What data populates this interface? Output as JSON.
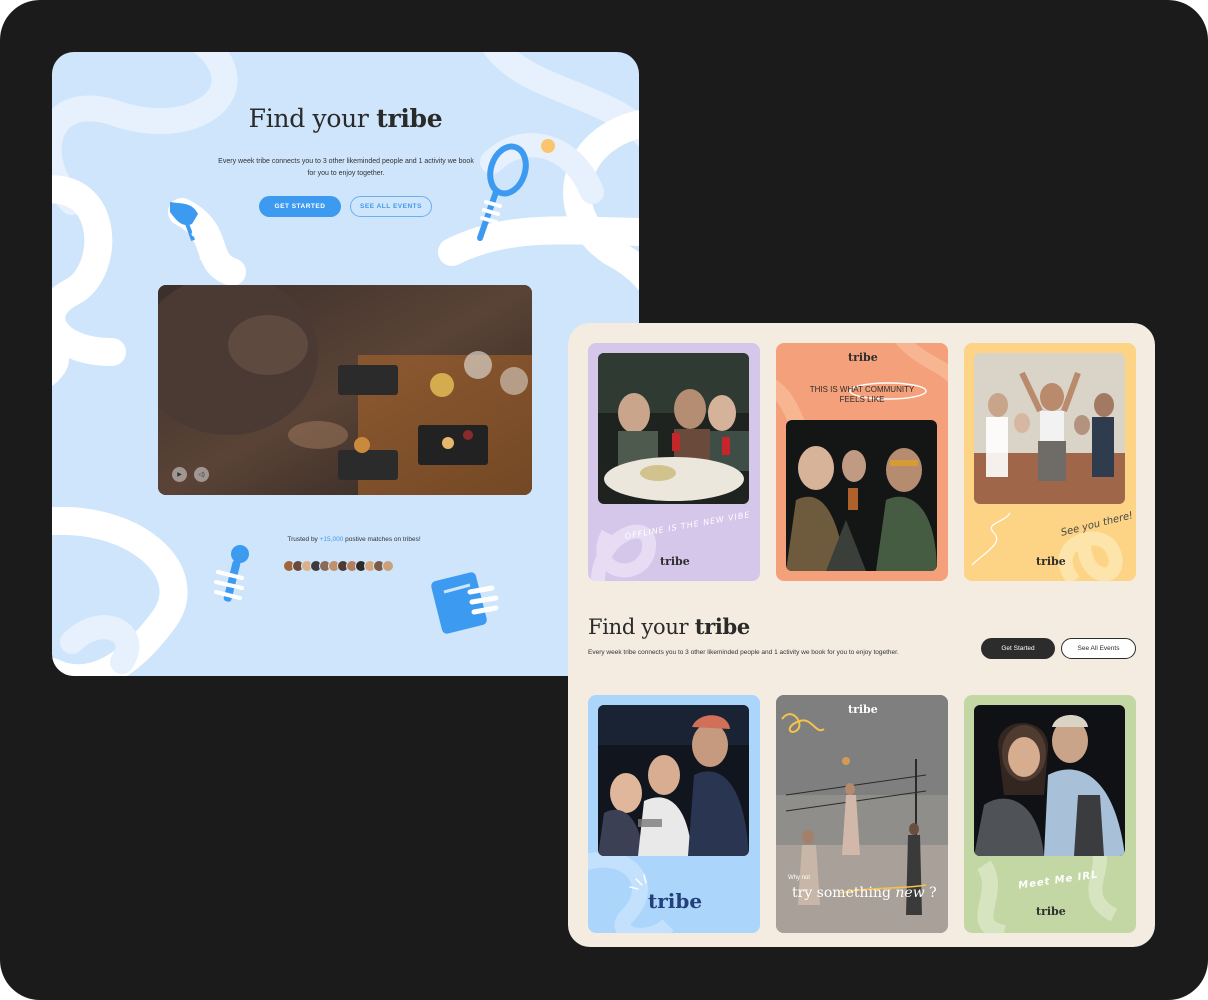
{
  "landing": {
    "title_light": "Find your",
    "title_bold": "tribe",
    "subtitle": "Every week tribe connects you to 3 other likeminded people and 1 activity we book for you to enjoy together.",
    "cta_primary": "GET STARTED",
    "cta_secondary": "SEE ALL EVENTS",
    "video": {
      "play_icon": "play-icon",
      "volume_icon": "volume-icon"
    },
    "trusted_prefix": "Trusted by",
    "trusted_count": "+15,000",
    "trusted_suffix": "postive matches on tribes!",
    "accent_color": "#3d9af1",
    "background_color": "#cfe5fb"
  },
  "cards_top": [
    {
      "caption": "OFFLINE IS THE NEW VIBE",
      "brand": "tribe",
      "bg": "#d4c7ea"
    },
    {
      "headline_line1": "THIS IS WHAT COMMUNITY",
      "headline_line2": "FEELS LIKE",
      "brand": "tribe",
      "bg": "#f4a07a"
    },
    {
      "caption": "See you there!",
      "brand": "tribe",
      "bg": "#fdd486"
    }
  ],
  "section": {
    "title_light": "Find your",
    "title_bold": "tribe",
    "subtitle": "Every week tribe connects you to 3 other likeminded people and 1 activity we book for you to enjoy together.",
    "cta_primary": "Get Started",
    "cta_secondary": "See All Events",
    "background_color": "#f4ece1"
  },
  "cards_bottom": [
    {
      "brand": "tribe",
      "bg": "#abd5fb"
    },
    {
      "brand": "tribe",
      "small": "Why not",
      "headline": "try something",
      "headline_em": "new",
      "headline_end": "?"
    },
    {
      "caption": "Meet Me IRL",
      "brand": "tribe",
      "bg": "#c3d7a4"
    }
  ]
}
